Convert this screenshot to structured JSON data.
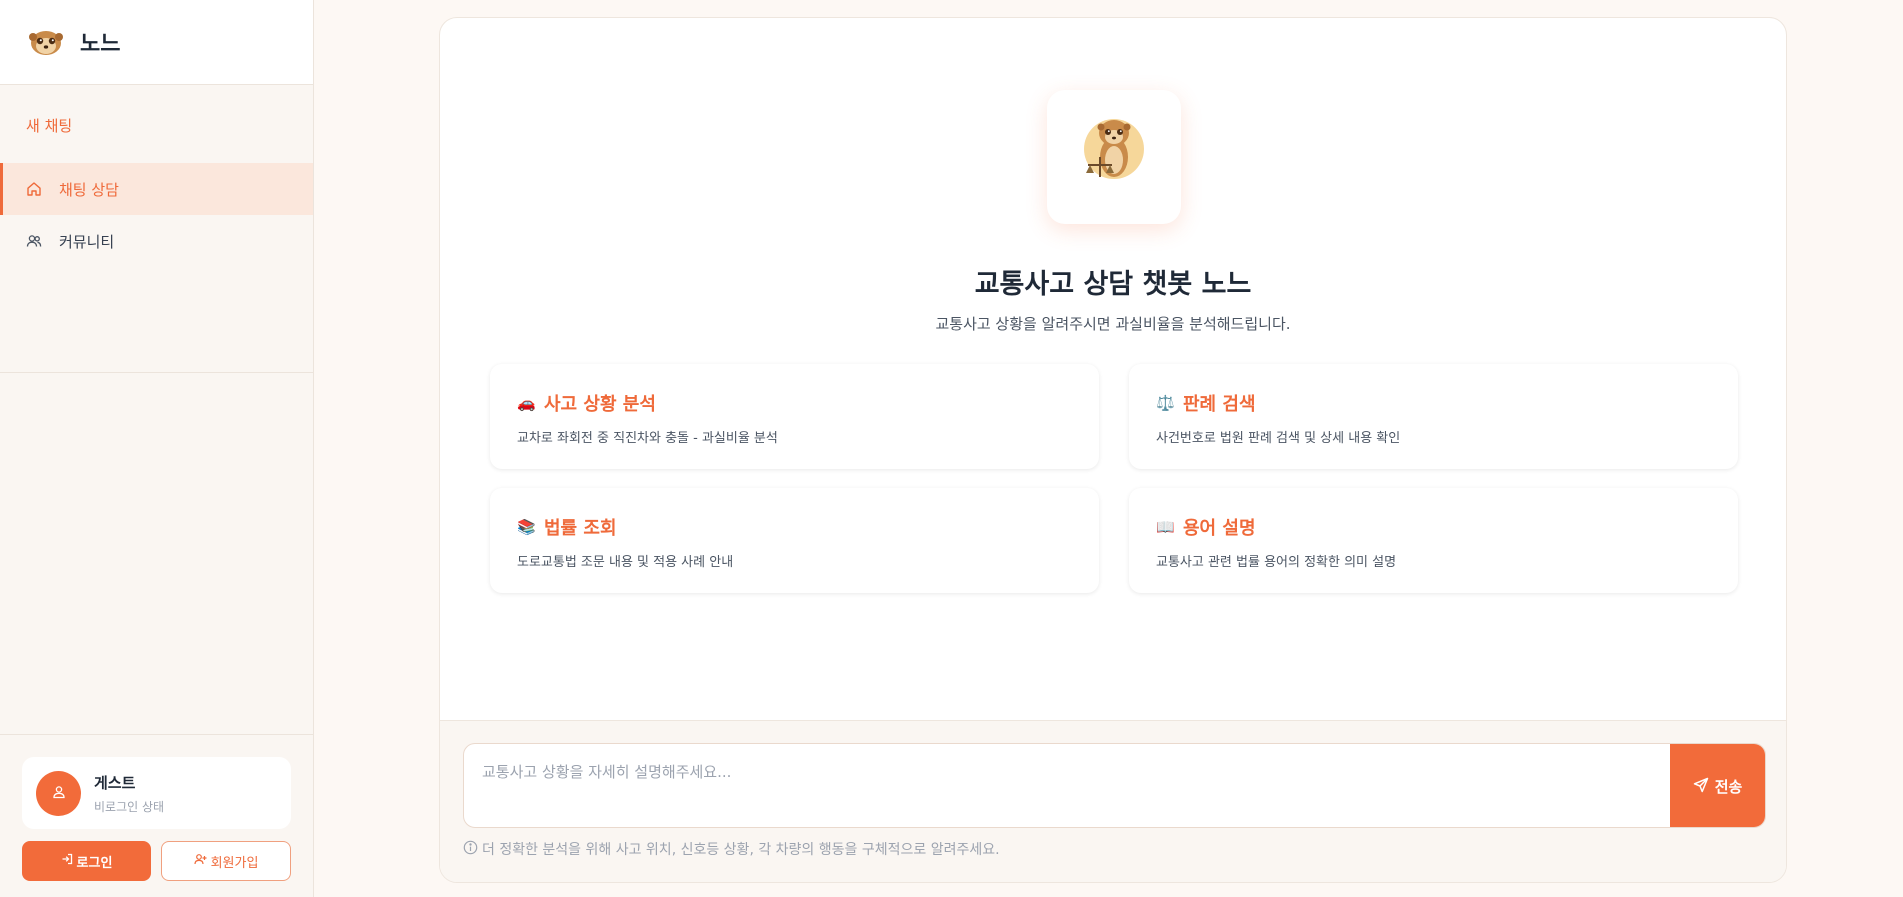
{
  "brand": {
    "name": "노느",
    "logo_icon": "meerkat-logo-icon"
  },
  "sidebar": {
    "new_chat": "새 채팅",
    "items": [
      {
        "label": "채팅 상담",
        "icon": "home-icon",
        "active": true
      },
      {
        "label": "커뮤니티",
        "icon": "users-icon",
        "active": false
      }
    ]
  },
  "user": {
    "name": "게스트",
    "status": "비로그인 상태",
    "avatar_icon": "user-icon"
  },
  "auth": {
    "login_label": "로그인",
    "signup_label": "회원가입"
  },
  "hero": {
    "logo_caption": "노느",
    "title": "교통사고 상담 챗봇 노느",
    "subtitle": "교통사고 상황을 알려주시면 과실비율을 분석해드립니다."
  },
  "cards": [
    {
      "emoji": "🚗",
      "title": "사고 상황 분석",
      "desc": "교차로 좌회전 중 직진차와 충돌 - 과실비율 분석"
    },
    {
      "emoji": "⚖️",
      "title": "판례 검색",
      "desc": "사건번호로 법원 판례 검색 및 상세 내용 확인"
    },
    {
      "emoji": "📚",
      "title": "법률 조회",
      "desc": "도로교통법 조문 내용 및 적용 사례 안내"
    },
    {
      "emoji": "📖",
      "title": "용어 설명",
      "desc": "교통사고 관련 법률 용어의 정확한 의미 설명"
    }
  ],
  "chat": {
    "placeholder": "교통사고 상황을 자세히 설명해주세요...",
    "send_label": "전송",
    "hint": "더 정확한 분석을 위해 사고 위치, 신호등 상황, 각 차량의 행동을 구체적으로 알려주세요."
  },
  "colors": {
    "accent": "#f26b3a",
    "accent_text": "#ef6a3a",
    "background": "#fdf8f4"
  }
}
